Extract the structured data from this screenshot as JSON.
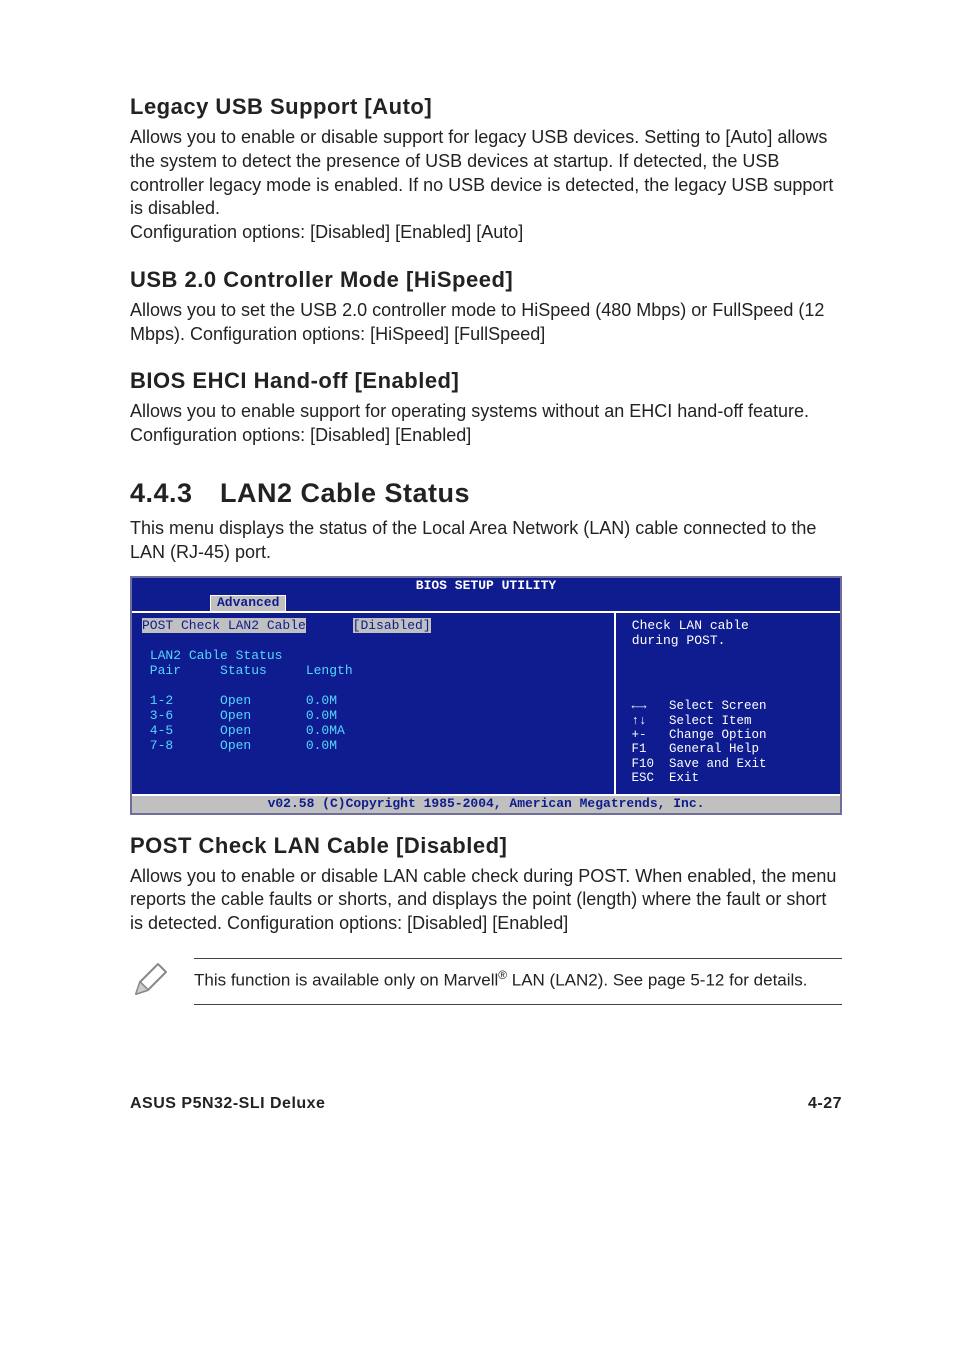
{
  "sections": {
    "legacy": {
      "title": "Legacy USB Support [Auto]",
      "body": "Allows you to enable or disable support for legacy USB devices. Setting to [Auto] allows the system to detect the presence of USB devices at startup. If detected, the USB controller legacy mode is enabled. If no USB device is detected, the legacy USB support is disabled.\nConfiguration options: [Disabled] [Enabled] [Auto]"
    },
    "usb2": {
      "title": "USB 2.0 Controller Mode [HiSpeed]",
      "body": "Allows you to set the USB 2.0 controller mode to HiSpeed (480 Mbps) or FullSpeed (12 Mbps). Configuration options: [HiSpeed] [FullSpeed]"
    },
    "ehci": {
      "title": "BIOS EHCI Hand-off [Enabled]",
      "body": "Allows you to enable support for operating systems without an EHCI hand-off feature. Configuration options: [Disabled] [Enabled]"
    },
    "lan2": {
      "number": "4.4.3",
      "title": "LAN2 Cable Status",
      "intro": "This menu displays the status of the Local Area Network (LAN) cable connected to the LAN (RJ-45) port."
    },
    "postcheck": {
      "title": "POST Check LAN Cable [Disabled]",
      "body": "Allows you to enable or disable LAN cable check during POST. When enabled, the menu reports the cable faults or shorts, and displays the point (length) where the fault or short is detected. Configuration options: [Disabled] [Enabled]"
    }
  },
  "bios": {
    "utility_title": "BIOS SETUP UTILITY",
    "tab": "Advanced",
    "row_label": "POST Check LAN2 Cable",
    "row_value": "[Disabled]",
    "table_title": "LAN2 Cable Status",
    "columns": " Pair     Status     Length",
    "rows": [
      " 1-2      Open       0.0M",
      " 3-6      Open       0.0M",
      " 4-5      Open       0.0MA",
      " 7-8      Open       0.0M"
    ],
    "help": " Check LAN cable\n during POST.",
    "keys": " ←→   Select Screen\n ↑↓   Select Item\n +-   Change Option\n F1   General Help\n F10  Save and Exit\n ESC  Exit",
    "copyright": "v02.58 (C)Copyright 1985-2004, American Megatrends, Inc."
  },
  "note": {
    "text_a": "This function is available only on Marvell",
    "sup": "®",
    "text_b": " LAN (LAN2). See page 5-12 for details."
  },
  "footer": {
    "left": "ASUS P5N32-SLI Deluxe",
    "right": "4-27"
  }
}
